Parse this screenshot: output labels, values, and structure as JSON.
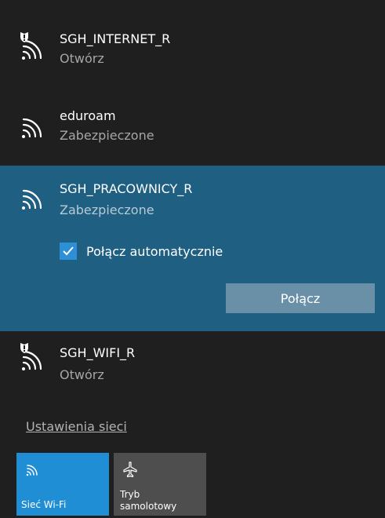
{
  "networks": [
    {
      "name": "SGH_INTERNET_R",
      "status": "Otwórz",
      "secured": false,
      "icon": "wifi-open-shield-icon"
    },
    {
      "name": "eduroam",
      "status": "Zabezpieczone",
      "secured": true,
      "icon": "wifi-icon"
    },
    {
      "name": "SGH_PRACOWNICY_R",
      "status": "Zabezpieczone",
      "secured": true,
      "icon": "wifi-icon",
      "selected": true
    },
    {
      "name": "SGH_WIFI_R",
      "status": "Otwórz",
      "secured": false,
      "icon": "wifi-open-shield-icon"
    }
  ],
  "selected_network": {
    "auto_connect_label": "Połącz automatycznie",
    "auto_connect_checked": true,
    "connect_label": "Połącz"
  },
  "settings_link": "Ustawienia sieci",
  "quick_actions": {
    "wifi": {
      "label": "Sieć Wi-Fi",
      "active": true,
      "icon": "wifi-icon"
    },
    "airplane": {
      "label_line1": "Tryb",
      "label_line2": "samolotowy",
      "active": false,
      "icon": "airplane-icon"
    }
  },
  "colors": {
    "background": "#1f1f1f",
    "selected_background": "#1e5f82",
    "accent": "#1f8ed4",
    "connect_button": "#6a90a8",
    "secondary_text": "#a6a6a6",
    "tile_inactive": "#4e4e4e"
  }
}
